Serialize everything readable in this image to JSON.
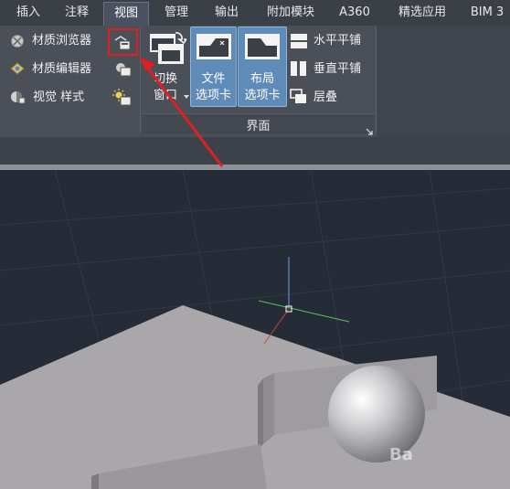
{
  "tabs": [
    {
      "label": "插入",
      "active": false
    },
    {
      "label": "注释",
      "active": false
    },
    {
      "label": "视图",
      "active": true
    },
    {
      "label": "管理",
      "active": false
    },
    {
      "label": "输出",
      "active": false
    },
    {
      "label": "附加模块",
      "active": false
    },
    {
      "label": "A360",
      "active": false
    },
    {
      "label": "精选应用",
      "active": false
    },
    {
      "label": "BIM 3",
      "active": false
    }
  ],
  "visual_styles_panel": {
    "material_browser": "材质浏览器",
    "material_editor": "材质编辑器",
    "visual_styles": "视觉 样式"
  },
  "interface_panel": {
    "switch_window_line1": "切换",
    "switch_window_line2": "窗口",
    "file_tabs_line1": "文件",
    "file_tabs_line2": "选项卡",
    "layout_tabs_line1": "布局",
    "layout_tabs_line2": "选项卡",
    "tile_horizontal": "水平平铺",
    "tile_vertical": "垂直平铺",
    "cascade": "层叠",
    "title": "界面"
  },
  "watermark": "Ba",
  "colors": {
    "highlight": "#e02020",
    "selected_button": "#5f8bb8",
    "viewport_bg": "#252b37",
    "model_gray": "#a9a7aa"
  }
}
